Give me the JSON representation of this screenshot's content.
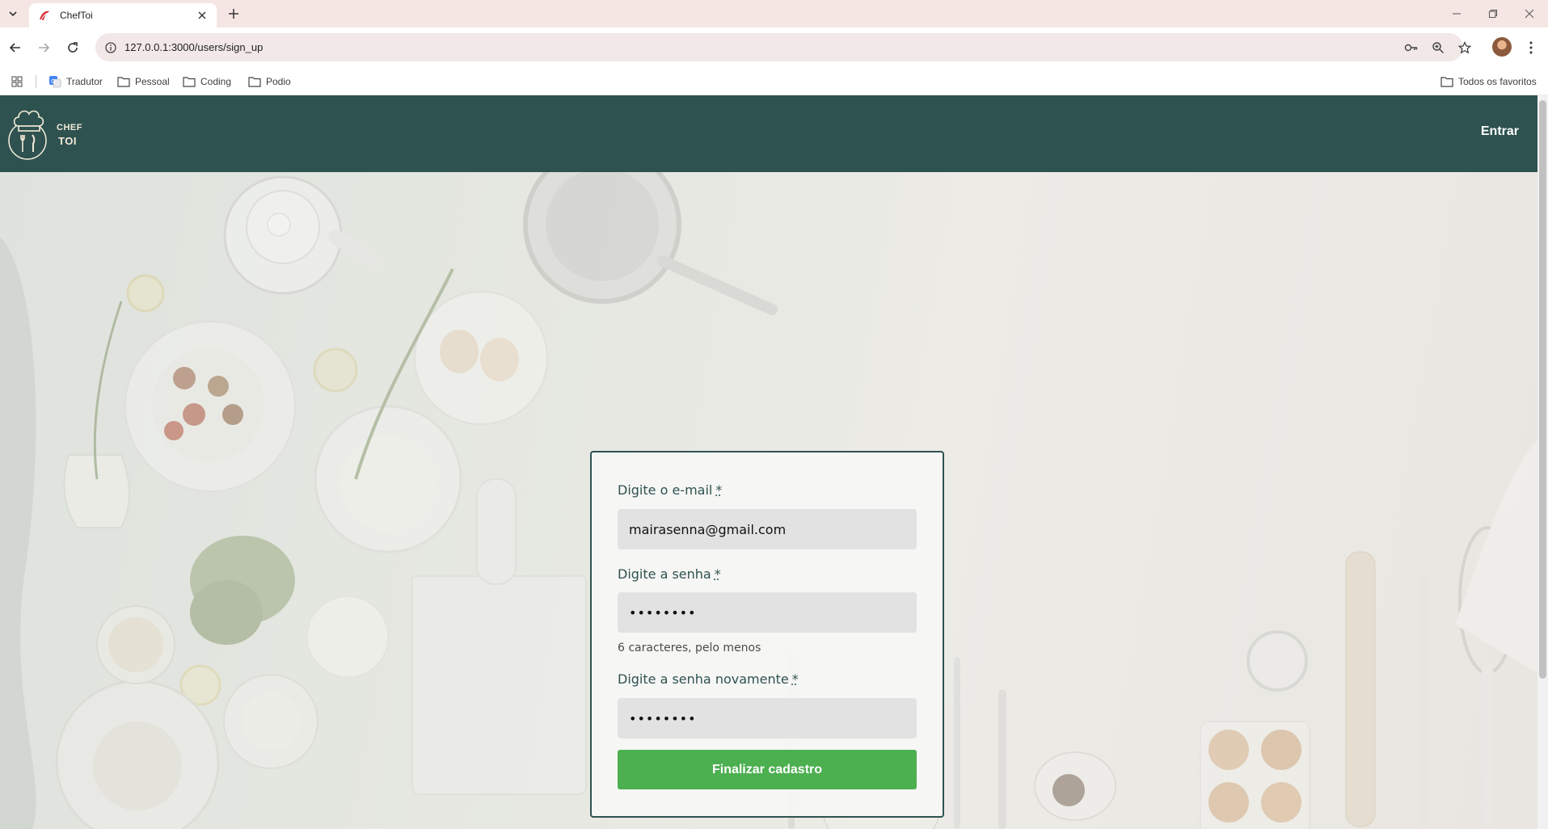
{
  "browser": {
    "tab_title": "ChefToi",
    "url": "127.0.0.1:3000/users/sign_up",
    "bookmarks": [
      "Tradutor",
      "Pessoal",
      "Coding",
      "Podio"
    ],
    "all_bookmarks": "Todos os favoritos"
  },
  "navbar": {
    "logo_line1": "CHEF",
    "logo_line2": "TOI",
    "login_link": "Entrar"
  },
  "form": {
    "email_label": "Digite o e-mail",
    "email_value": "mairasenna@gmail.com",
    "password_label": "Digite a senha",
    "password_value": "••••••••",
    "password_hint": "6 caracteres, pelo menos",
    "password_confirm_label": "Digite a senha novamente",
    "password_confirm_value": "••••••••",
    "required_marker": "*",
    "submit_label": "Finalizar cadastro"
  },
  "colors": {
    "navbar": "#2e5250",
    "submit": "#4caf50",
    "input_bg": "#e2e2e2"
  }
}
